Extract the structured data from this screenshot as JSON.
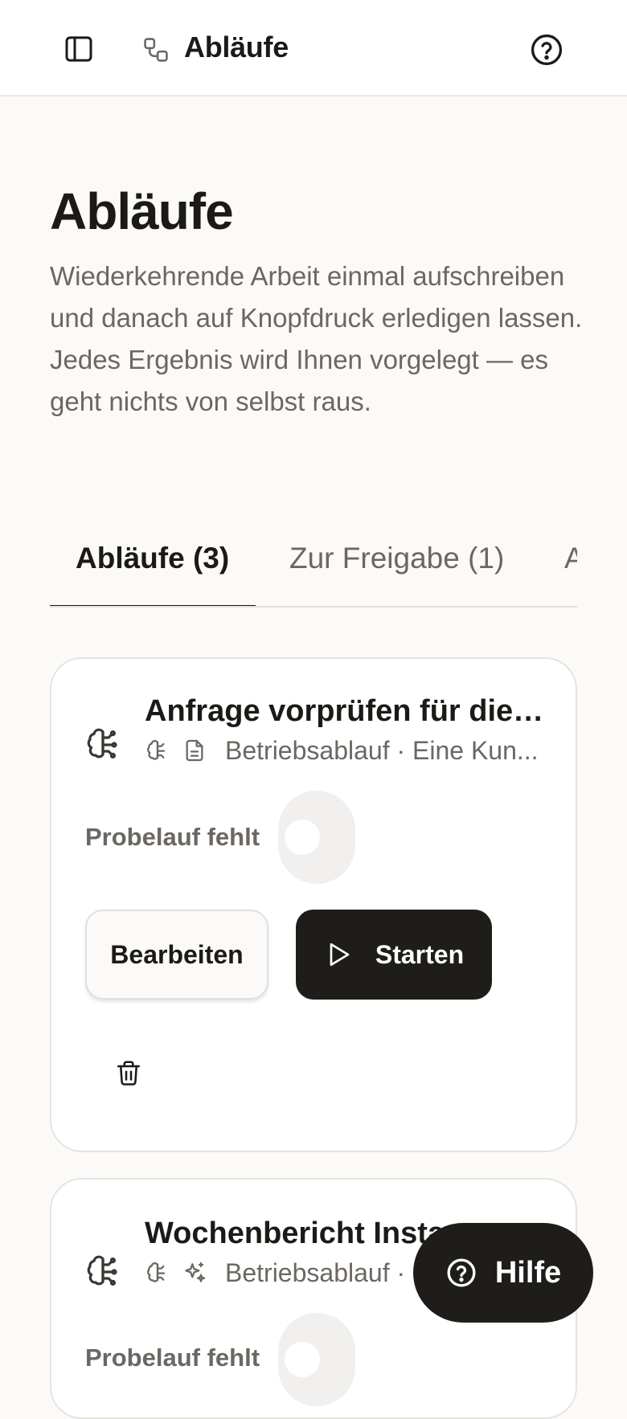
{
  "topbar": {
    "title": "Abläufe",
    "sidebar_icon": "sidebar-panel-icon",
    "workflow_icon": "workflow-icon",
    "help_icon": "help-circle-icon"
  },
  "page": {
    "title": "Abläufe",
    "description": "Wiederkehrende Arbeit einmal aufschreiben und danach auf Knopfdruck erledigen lassen. Jedes Ergebnis wird Ihnen vorgelegt — es geht nichts von selbst raus."
  },
  "tabs": [
    {
      "label": "Abläufe (3)",
      "active": true
    },
    {
      "label": "Zur Freigabe (1)",
      "active": false
    },
    {
      "label": "A",
      "active": false
    }
  ],
  "cards": [
    {
      "title": "Anfrage vorprüfen für die ...",
      "meta": "Betriebsablauf · Eine Kun...",
      "meta_icons": [
        "brain-icon",
        "document-icon"
      ],
      "trial_label": "Probelauf fehlt",
      "toggle_on": false,
      "edit_label": "Bearbeiten",
      "start_label": "Starten"
    },
    {
      "title": "Wochenbericht Instagram",
      "meta": "Betriebsablauf ·",
      "meta_icons": [
        "brain-icon",
        "sparkles-icon"
      ],
      "trial_label": "Probelauf fehlt",
      "toggle_on": false
    }
  ],
  "help_fab": {
    "label": "Hilfe"
  },
  "colors": {
    "accent_dark": "#1f1d1a",
    "background": "#fbfaf8",
    "muted_text": "#6b6762"
  }
}
